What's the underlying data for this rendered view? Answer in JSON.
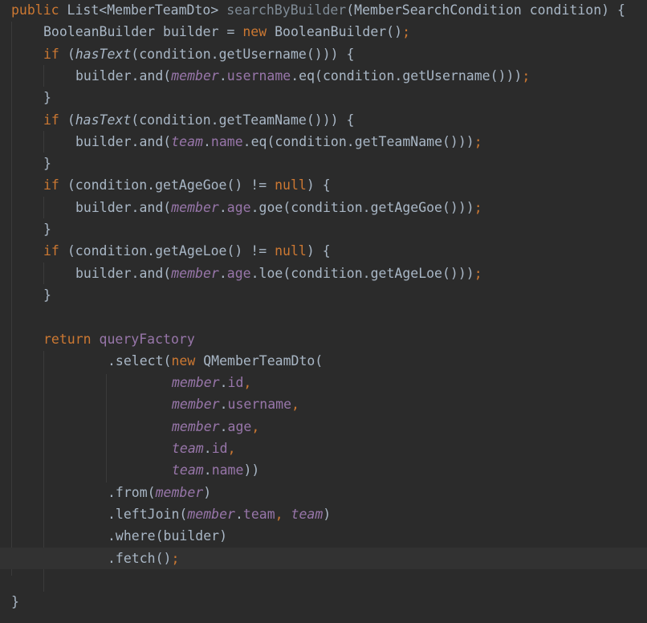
{
  "colors": {
    "background": "#2b2b2b",
    "current_line": "#323232",
    "plain": "#a9b7c6",
    "keyword": "#cc7832",
    "method_declaration": "#ffc66d",
    "unused_method": "#7f8b96",
    "field": "#9876aa",
    "indent_guide": "#3b3b3b"
  },
  "editor": {
    "current_line_index": 25,
    "lines": [
      {
        "indent": 0,
        "tokens": [
          {
            "text": "public ",
            "style": "kw"
          },
          {
            "text": "List<MemberTeamDto> ",
            "style": "plain"
          },
          {
            "text": "searchByBuilder",
            "style": "dim"
          },
          {
            "text": "(MemberSearchCondition condition) {",
            "style": "plain"
          }
        ]
      },
      {
        "indent": 4,
        "tokens": [
          {
            "text": "BooleanBuilder builder = ",
            "style": "plain"
          },
          {
            "text": "new ",
            "style": "kw"
          },
          {
            "text": "BooleanBuilder()",
            "style": "plain"
          },
          {
            "text": ";",
            "style": "kw"
          }
        ]
      },
      {
        "indent": 4,
        "tokens": [
          {
            "text": "if ",
            "style": "kw"
          },
          {
            "text": "(",
            "style": "plain"
          },
          {
            "text": "hasText",
            "style": "ital"
          },
          {
            "text": "(condition.getUsername())) {",
            "style": "plain"
          }
        ]
      },
      {
        "indent": 8,
        "tokens": [
          {
            "text": "builder.and(",
            "style": "plain"
          },
          {
            "text": "member",
            "style": "field"
          },
          {
            "text": ".",
            "style": "plain"
          },
          {
            "text": "username",
            "style": "prop"
          },
          {
            "text": ".eq(condition.getUsername()))",
            "style": "plain"
          },
          {
            "text": ";",
            "style": "kw"
          }
        ]
      },
      {
        "indent": 4,
        "tokens": [
          {
            "text": "}",
            "style": "plain"
          }
        ]
      },
      {
        "indent": 4,
        "tokens": [
          {
            "text": "if ",
            "style": "kw"
          },
          {
            "text": "(",
            "style": "plain"
          },
          {
            "text": "hasText",
            "style": "ital"
          },
          {
            "text": "(condition.getTeamName())) {",
            "style": "plain"
          }
        ]
      },
      {
        "indent": 8,
        "tokens": [
          {
            "text": "builder.and(",
            "style": "plain"
          },
          {
            "text": "team",
            "style": "field"
          },
          {
            "text": ".",
            "style": "plain"
          },
          {
            "text": "name",
            "style": "prop"
          },
          {
            "text": ".eq(condition.getTeamName()))",
            "style": "plain"
          },
          {
            "text": ";",
            "style": "kw"
          }
        ]
      },
      {
        "indent": 4,
        "tokens": [
          {
            "text": "}",
            "style": "plain"
          }
        ]
      },
      {
        "indent": 4,
        "tokens": [
          {
            "text": "if ",
            "style": "kw"
          },
          {
            "text": "(condition.getAgeGoe() != ",
            "style": "plain"
          },
          {
            "text": "null",
            "style": "kw"
          },
          {
            "text": ") {",
            "style": "plain"
          }
        ]
      },
      {
        "indent": 8,
        "tokens": [
          {
            "text": "builder.and(",
            "style": "plain"
          },
          {
            "text": "member",
            "style": "field"
          },
          {
            "text": ".",
            "style": "plain"
          },
          {
            "text": "age",
            "style": "prop"
          },
          {
            "text": ".goe(condition.getAgeGoe()))",
            "style": "plain"
          },
          {
            "text": ";",
            "style": "kw"
          }
        ]
      },
      {
        "indent": 4,
        "tokens": [
          {
            "text": "}",
            "style": "plain"
          }
        ]
      },
      {
        "indent": 4,
        "tokens": [
          {
            "text": "if ",
            "style": "kw"
          },
          {
            "text": "(condition.getAgeLoe() != ",
            "style": "plain"
          },
          {
            "text": "null",
            "style": "kw"
          },
          {
            "text": ") {",
            "style": "plain"
          }
        ]
      },
      {
        "indent": 8,
        "tokens": [
          {
            "text": "builder.and(",
            "style": "plain"
          },
          {
            "text": "member",
            "style": "field"
          },
          {
            "text": ".",
            "style": "plain"
          },
          {
            "text": "age",
            "style": "prop"
          },
          {
            "text": ".loe(condition.getAgeLoe()))",
            "style": "plain"
          },
          {
            "text": ";",
            "style": "kw"
          }
        ]
      },
      {
        "indent": 4,
        "tokens": [
          {
            "text": "}",
            "style": "plain"
          }
        ]
      },
      {
        "indent": 0,
        "tokens": []
      },
      {
        "indent": 4,
        "tokens": [
          {
            "text": "return ",
            "style": "kw"
          },
          {
            "text": "queryFactory",
            "style": "prop"
          }
        ]
      },
      {
        "indent": 12,
        "tokens": [
          {
            "text": ".select(",
            "style": "plain"
          },
          {
            "text": "new ",
            "style": "kw"
          },
          {
            "text": "QMemberTeamDto(",
            "style": "plain"
          }
        ]
      },
      {
        "indent": 20,
        "tokens": [
          {
            "text": "member",
            "style": "field"
          },
          {
            "text": ".",
            "style": "plain"
          },
          {
            "text": "id",
            "style": "prop"
          },
          {
            "text": ",",
            "style": "kw"
          }
        ]
      },
      {
        "indent": 20,
        "tokens": [
          {
            "text": "member",
            "style": "field"
          },
          {
            "text": ".",
            "style": "plain"
          },
          {
            "text": "username",
            "style": "prop"
          },
          {
            "text": ",",
            "style": "kw"
          }
        ]
      },
      {
        "indent": 20,
        "tokens": [
          {
            "text": "member",
            "style": "field"
          },
          {
            "text": ".",
            "style": "plain"
          },
          {
            "text": "age",
            "style": "prop"
          },
          {
            "text": ",",
            "style": "kw"
          }
        ]
      },
      {
        "indent": 20,
        "tokens": [
          {
            "text": "team",
            "style": "field"
          },
          {
            "text": ".",
            "style": "plain"
          },
          {
            "text": "id",
            "style": "prop"
          },
          {
            "text": ",",
            "style": "kw"
          }
        ]
      },
      {
        "indent": 20,
        "tokens": [
          {
            "text": "team",
            "style": "field"
          },
          {
            "text": ".",
            "style": "plain"
          },
          {
            "text": "name",
            "style": "prop"
          },
          {
            "text": "))",
            "style": "plain"
          }
        ]
      },
      {
        "indent": 12,
        "tokens": [
          {
            "text": ".from(",
            "style": "plain"
          },
          {
            "text": "member",
            "style": "field"
          },
          {
            "text": ")",
            "style": "plain"
          }
        ]
      },
      {
        "indent": 12,
        "tokens": [
          {
            "text": ".leftJoin(",
            "style": "plain"
          },
          {
            "text": "member",
            "style": "field"
          },
          {
            "text": ".",
            "style": "plain"
          },
          {
            "text": "team",
            "style": "prop"
          },
          {
            "text": ", ",
            "style": "kw"
          },
          {
            "text": "team",
            "style": "field"
          },
          {
            "text": ")",
            "style": "plain"
          }
        ]
      },
      {
        "indent": 12,
        "tokens": [
          {
            "text": ".where(builder)",
            "style": "plain"
          }
        ]
      },
      {
        "indent": 12,
        "tokens": [
          {
            "text": ".fetch()",
            "style": "plain"
          },
          {
            "text": ";",
            "style": "kw"
          }
        ]
      },
      {
        "indent": 0,
        "tokens": []
      },
      {
        "indent": 0,
        "tokens": [
          {
            "text": "}",
            "style": "plain"
          }
        ]
      }
    ]
  }
}
